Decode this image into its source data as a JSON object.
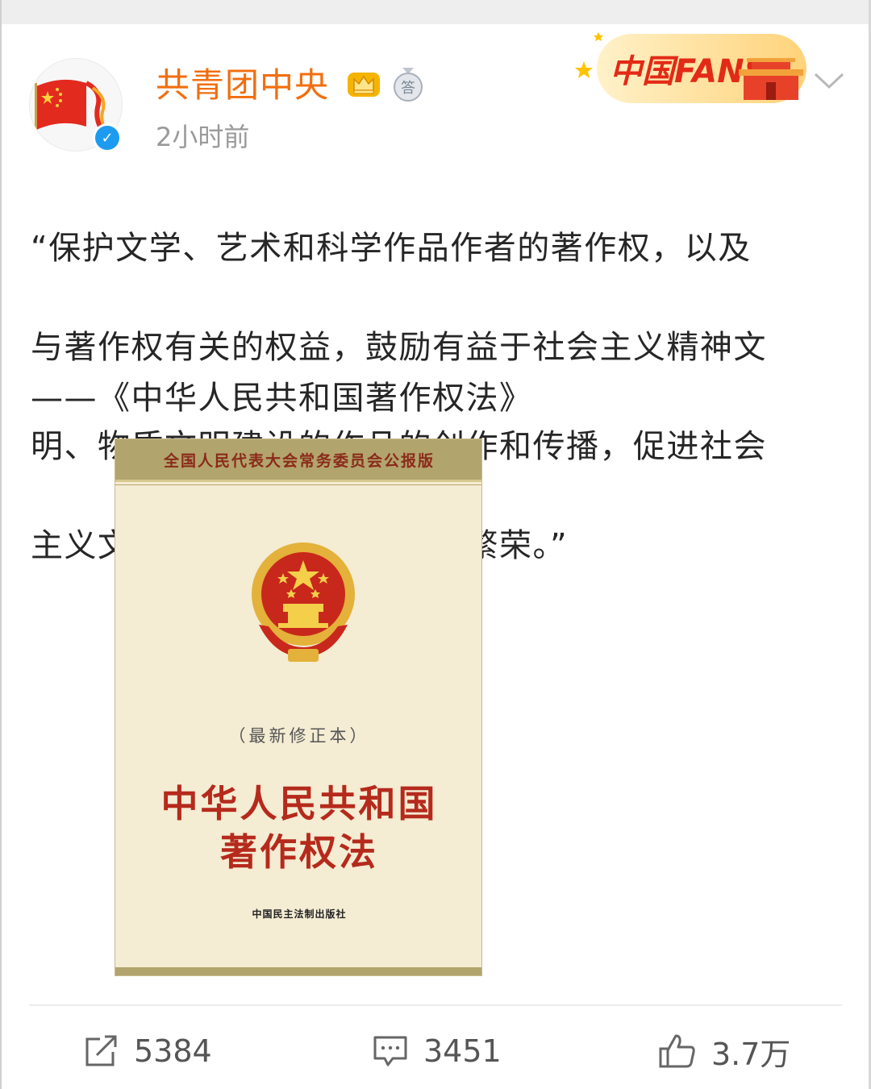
{
  "post": {
    "author": "共青团中央",
    "timestamp": "2小时前",
    "text_lines": [
      "“保护文学、艺术和科学作品作者的著作权，以及",
      "与著作权有关的权益，鼓励有益于社会主义精神文",
      "明、物质文明建设的作品的创作和传播，促进社会",
      "主义文化和科学事业的发展与繁荣。”"
    ],
    "source": "——《中华人民共和国著作权法》"
  },
  "banner": {
    "text": "中国FANS"
  },
  "medal_char": "答",
  "book": {
    "header": "全国人民代表大会常务委员会公报版",
    "edition": "（最新修正本）",
    "title_line1": "中华人民共和国",
    "title_line2": "著作权法",
    "publisher": "中国民主法制出版社"
  },
  "actions": {
    "repost_count": "5384",
    "comment_count": "3451",
    "like_count": "3.7万"
  },
  "colors": {
    "username": "#f26e0f",
    "verified": "#1d9bf0",
    "book_title": "#b52a1c"
  }
}
